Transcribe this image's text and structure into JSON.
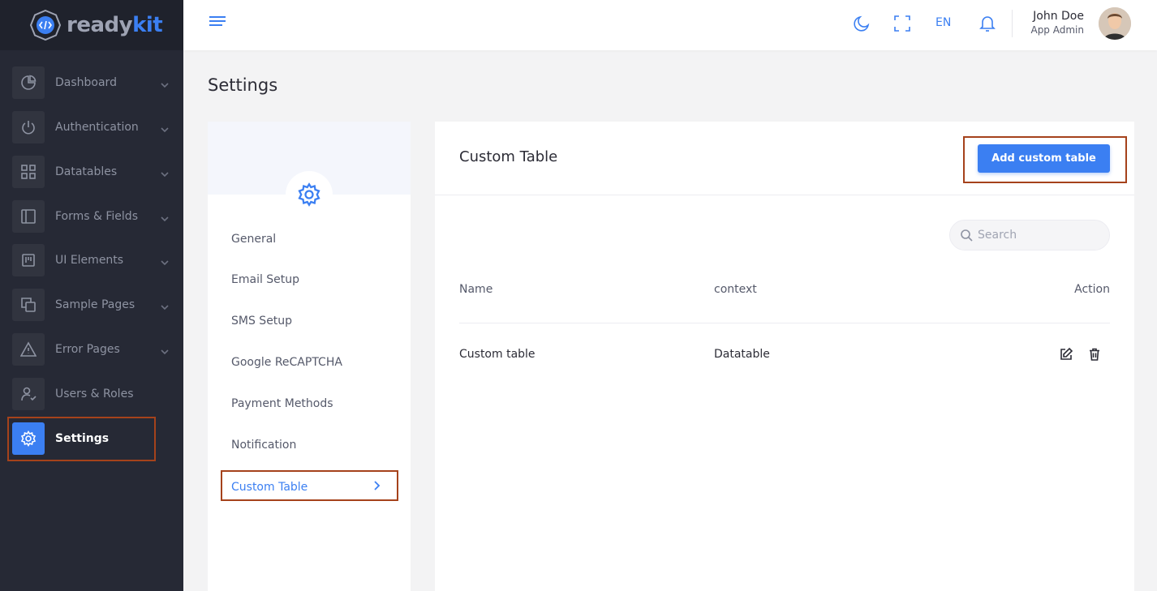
{
  "brand": {
    "part1": "ready",
    "part2": "kit"
  },
  "sidebar": {
    "items": [
      {
        "label": "Dashboard",
        "icon": "pie-chart-icon"
      },
      {
        "label": "Authentication",
        "icon": "power-icon"
      },
      {
        "label": "Datatables",
        "icon": "grid-icon"
      },
      {
        "label": "Forms & Fields",
        "icon": "sidebar-layout-icon"
      },
      {
        "label": "UI Elements",
        "icon": "board-icon"
      },
      {
        "label": "Sample Pages",
        "icon": "copy-icon"
      },
      {
        "label": "Error Pages",
        "icon": "warning-icon"
      },
      {
        "label": "Users & Roles",
        "icon": "user-check-icon"
      },
      {
        "label": "Settings",
        "icon": "gear-icon"
      }
    ]
  },
  "topbar": {
    "language": "EN",
    "user_name": "John Doe",
    "user_role": "App Admin"
  },
  "page": {
    "title": "Settings"
  },
  "settings_menu": {
    "items": [
      "General",
      "Email Setup",
      "SMS Setup",
      "Google ReCAPTCHA",
      "Payment Methods",
      "Notification",
      "Custom Table"
    ]
  },
  "content": {
    "title": "Custom Table",
    "add_button": "Add custom table",
    "search_placeholder": "Search",
    "columns": [
      "Name",
      "context",
      "Action"
    ],
    "rows": [
      {
        "name": "Custom table",
        "context": "Datatable"
      }
    ]
  },
  "colors": {
    "accent": "#3b7ff2",
    "sidebar_bg": "#262935",
    "highlight": "#a5421b"
  }
}
